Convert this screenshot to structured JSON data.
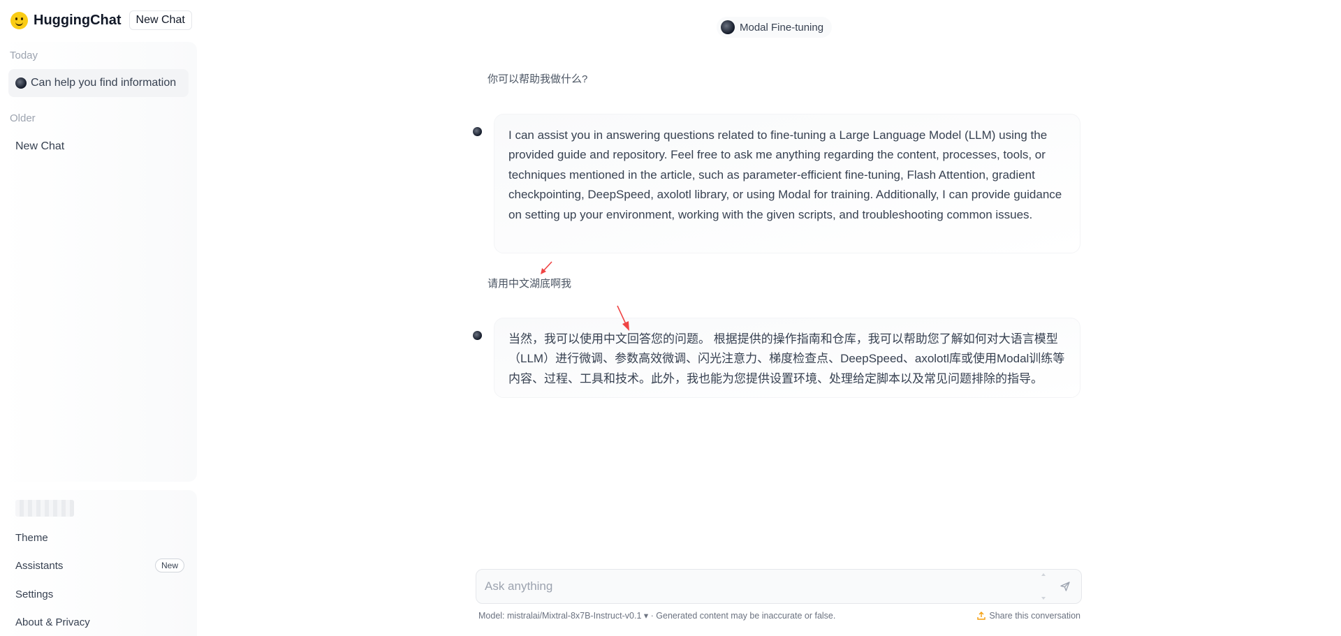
{
  "app": {
    "name": "HuggingChat",
    "new_chat_label": "New Chat"
  },
  "sidebar": {
    "groups": [
      {
        "label": "Today",
        "items": [
          {
            "title": "Can help you find information",
            "active": true
          }
        ]
      },
      {
        "label": "Older",
        "items": [
          {
            "title": "New Chat",
            "active": false
          }
        ]
      }
    ],
    "menu": {
      "theme": "Theme",
      "assistants": "Assistants",
      "assistants_badge": "New",
      "settings": "Settings",
      "about": "About & Privacy"
    }
  },
  "header": {
    "assistant_name": "Modal Fine-tuning"
  },
  "messages": [
    {
      "role": "user",
      "text": "你可以帮助我做什么?"
    },
    {
      "role": "assistant",
      "text": "I can assist you in answering questions related to fine-tuning a Large Language Model (LLM) using the provided guide and repository. Feel free to ask me anything regarding the content, processes, tools, or techniques mentioned in the article, such as parameter-efficient fine-tuning, Flash Attention, gradient checkpointing, DeepSpeed, axolotl library, or using Modal for training. Additionally, I can provide guidance on setting up your environment, working with the given scripts, and troubleshooting common issues."
    },
    {
      "role": "user",
      "text": "请用中文湖底啊我"
    },
    {
      "role": "assistant",
      "text": "当然，我可以使用中文回答您的问题。 根据提供的操作指南和仓库，我可以帮助您了解如何对大语言模型（LLM）进行微调、参数高效微调、闪光注意力、梯度检查点、DeepSpeed、axolotl库或使用Modal训练等内容、过程、工具和技术。此外，我也能为您提供设置环境、处理给定脚本以及常见问题排除的指导。"
    }
  ],
  "composer": {
    "placeholder": "Ask anything",
    "value": ""
  },
  "footer": {
    "model_prefix": "Model: ",
    "model_name": "mistralai/Mixtral-8x7B-Instruct-v0.1",
    "disclaimer": " · Generated content may be inaccurate or false.",
    "share_label": "Share this conversation"
  },
  "colors": {
    "accent_logo": "#facc15",
    "annotation_arrow": "#ef4444",
    "share_icon": "#f59e0b"
  },
  "icons": {
    "logo": "hugging-face-smile-icon",
    "send": "paper-plane-icon",
    "share": "upload-icon",
    "dropdown": "caret-down-icon"
  }
}
